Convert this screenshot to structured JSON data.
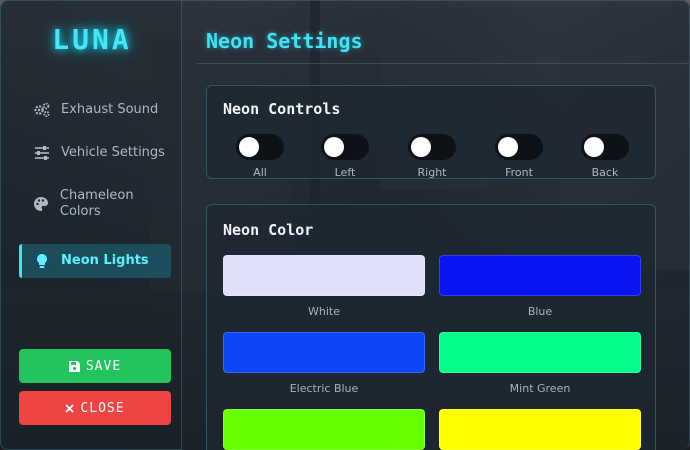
{
  "app": {
    "logo": "LUNA"
  },
  "sidebar": {
    "items": [
      {
        "label": "Exhaust Sound",
        "icon": "cogs-icon"
      },
      {
        "label": "Vehicle Settings",
        "icon": "sliders-icon"
      },
      {
        "label": "Chameleon Colors",
        "icon": "palette-icon"
      },
      {
        "label": "Neon Lights",
        "icon": "lightbulb-icon",
        "active": true
      }
    ],
    "save_label": "SAVE",
    "close_label": "CLOSE"
  },
  "main": {
    "title": "Neon Settings",
    "controls": {
      "title": "Neon Controls",
      "toggles": [
        {
          "label": "All",
          "on": false
        },
        {
          "label": "Left",
          "on": false
        },
        {
          "label": "Right",
          "on": false
        },
        {
          "label": "Front",
          "on": false
        },
        {
          "label": "Back",
          "on": false
        }
      ]
    },
    "color": {
      "title": "Neon Color",
      "swatches": [
        {
          "label": "White",
          "color": "#dfe1fb"
        },
        {
          "label": "Blue",
          "color": "#0a14f0"
        },
        {
          "label": "Electric Blue",
          "color": "#0d46f5"
        },
        {
          "label": "Mint Green",
          "color": "#05fb8c"
        },
        {
          "label": "",
          "color": "#66ff00"
        },
        {
          "label": "",
          "color": "#ffff00"
        }
      ]
    }
  },
  "colors": {
    "accent": "#3fe3f3",
    "save": "#22c45d",
    "close": "#ef4444"
  }
}
